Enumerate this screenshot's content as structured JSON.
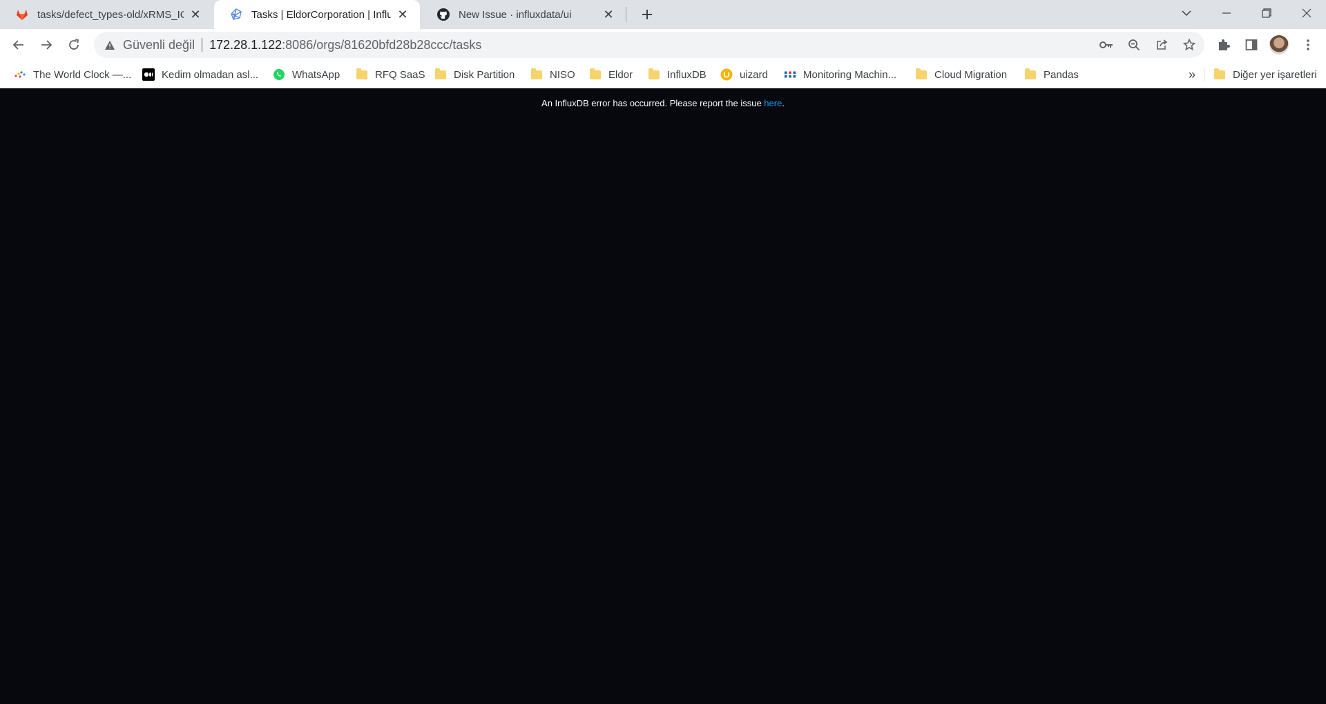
{
  "browser": {
    "tabs": [
      {
        "title": "tasks/defect_types-old/xRMS_IC_",
        "icon": "gitlab-icon",
        "active": false
      },
      {
        "title": "Tasks | EldorCorporation | InfluxD",
        "icon": "influxdb-icon",
        "active": true
      },
      {
        "title": "New Issue · influxdata/ui",
        "icon": "github-icon",
        "active": false
      }
    ],
    "address": {
      "security_label": "Güvenli değil",
      "host": "172.28.1.122",
      "rest": ":8086/orgs/81620bfd28b28ccc/tasks"
    }
  },
  "bookmarks": [
    {
      "label": "The World Clock —...",
      "icon": "world-clock-icon"
    },
    {
      "label": "Kedim olmadan asl...",
      "icon": "medium-icon"
    },
    {
      "label": "WhatsApp",
      "icon": "whatsapp-icon"
    },
    {
      "label": "RFQ SaaS",
      "icon": "folder-icon"
    },
    {
      "label": "Disk Partition",
      "icon": "folder-icon"
    },
    {
      "label": "NISO",
      "icon": "folder-icon"
    },
    {
      "label": "Eldor",
      "icon": "folder-icon"
    },
    {
      "label": "InfluxDB",
      "icon": "folder-icon"
    },
    {
      "label": "uizard",
      "icon": "uizard-icon"
    },
    {
      "label": "Monitoring Machin...",
      "icon": "monitoring-icon"
    },
    {
      "label": "Cloud Migration",
      "icon": "folder-icon"
    },
    {
      "label": "Pandas",
      "icon": "folder-icon"
    }
  ],
  "bookmarks_more": "»",
  "other_bookmarks": "Diğer yer işaretleri",
  "page": {
    "error_text": "An InfluxDB error has occurred. Please report the issue ",
    "error_link": "here",
    "error_suffix": "."
  },
  "colors": {
    "page_background": "#07080d",
    "link": "#00a3ff"
  }
}
